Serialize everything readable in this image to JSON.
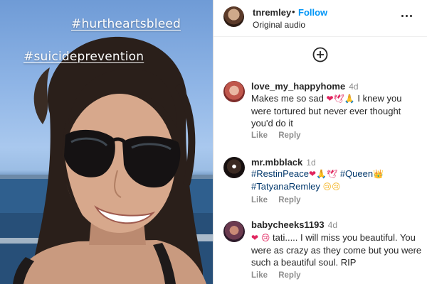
{
  "media": {
    "hashtags": [
      "#hurtheartsbleed",
      "#suicideprevention"
    ]
  },
  "header": {
    "username": "tnremley",
    "separator": "•",
    "follow_label": "Follow",
    "audio_label": "Original audio",
    "more_icon": "more-horizontal-icon"
  },
  "add_comment_icon": "add-circle-icon",
  "comments": [
    {
      "username": "love_my_happyhome",
      "time": "4d",
      "text": "Makes me so sad",
      "text_emoji": "❤🕊🙏",
      "text_rest": " I knew you were tortured but never ever thought you'd do it",
      "like_label": "Like",
      "reply_label": "Reply"
    },
    {
      "username": "mr.mbblack",
      "time": "1d",
      "tag1": "#RestinPeace",
      "tag1_emoji": "❤🙏🕊",
      "tag2": "#Queen",
      "tag2_emoji": "👑",
      "tag3": "#TatyanaRemley",
      "tag3_emoji": "😢😢",
      "like_label": "Like",
      "reply_label": "Reply"
    },
    {
      "username": "babycheeks1193",
      "time": "4d",
      "text_emoji": "❤ 😢",
      "text": " tati..... I will miss you beautiful. You were as crazy as they come but you were such a beautiful soul. RIP",
      "like_label": "Like",
      "reply_label": "Reply"
    }
  ],
  "colors": {
    "follow": "#0095f6",
    "hashtag_link": "#00376b",
    "secondary_text": "#8e8e8e"
  }
}
